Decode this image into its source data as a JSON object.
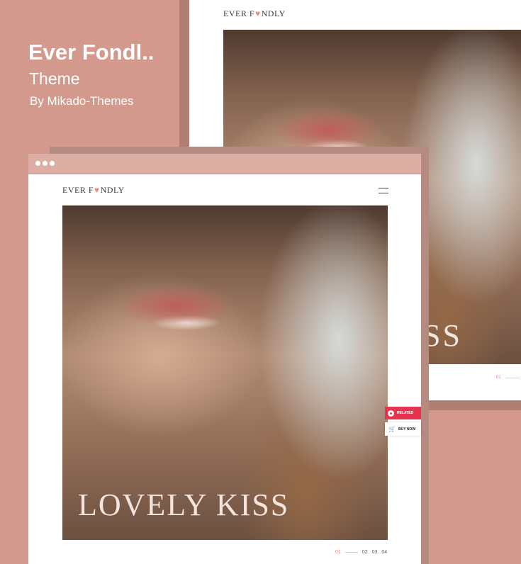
{
  "hero": {
    "title": "Ever Fondl..",
    "subtitle": "Theme",
    "author": "By Mikado-Themes"
  },
  "logo": {
    "before": "EVER F",
    "heart": "♥",
    "after": "NDLY"
  },
  "back_preview": {
    "slide_title": "SS",
    "pager_current": "01"
  },
  "front_preview": {
    "slide_title": "LOVELY KISS",
    "pager": {
      "current": "01",
      "others": [
        "02",
        "03",
        "04"
      ]
    }
  },
  "side_buttons": {
    "related": "RELATED",
    "buy": "BUY NOW"
  },
  "colors": {
    "background": "#d2998c",
    "titlebar": "#dcaea4",
    "accent": "#e8334e"
  }
}
